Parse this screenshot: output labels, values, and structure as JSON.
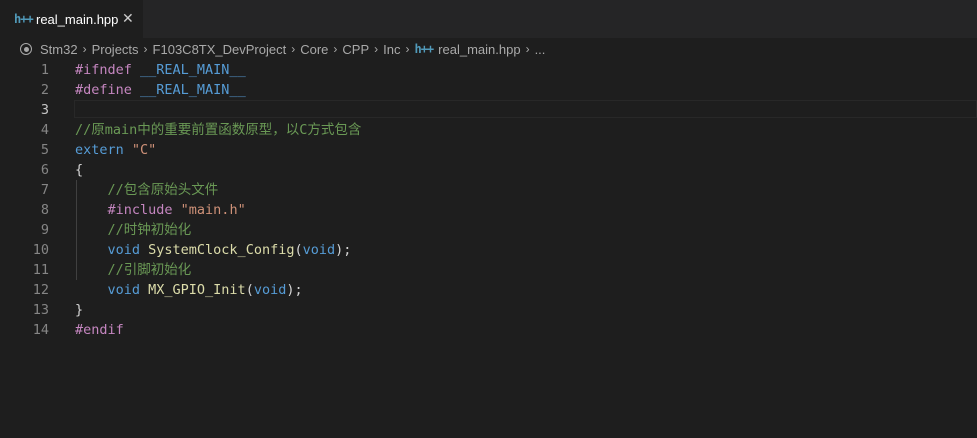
{
  "tab": {
    "icon_text": "h++",
    "label": "real_main.hpp",
    "close": "✕"
  },
  "breadcrumb": {
    "items": [
      "Stm32",
      "Projects",
      "F103C8TX_DevProject",
      "Core",
      "CPP",
      "Inc"
    ],
    "file_icon": "h++",
    "file": "real_main.hpp",
    "tail": "...",
    "separator": "›"
  },
  "lines": [
    {
      "n": "1",
      "parts": [
        [
          "pp",
          "#ifndef "
        ],
        [
          "macro",
          "__REAL_MAIN__"
        ]
      ]
    },
    {
      "n": "2",
      "parts": [
        [
          "pp",
          "#define "
        ],
        [
          "macro",
          "__REAL_MAIN__"
        ]
      ]
    },
    {
      "n": "3",
      "parts": [],
      "current": true
    },
    {
      "n": "4",
      "parts": [
        [
          "comment",
          "//原main中的重要前置函数原型，以C方式包含"
        ]
      ]
    },
    {
      "n": "5",
      "parts": [
        [
          "kw",
          "extern "
        ],
        [
          "str",
          "\"C\""
        ]
      ]
    },
    {
      "n": "6",
      "parts": [
        [
          "punc",
          "{"
        ]
      ]
    },
    {
      "n": "7",
      "parts": [
        [
          "punc",
          "    "
        ],
        [
          "comment",
          "//包含原始头文件"
        ]
      ]
    },
    {
      "n": "8",
      "parts": [
        [
          "punc",
          "    "
        ],
        [
          "pp",
          "#include "
        ],
        [
          "str",
          "\"main.h\""
        ]
      ]
    },
    {
      "n": "9",
      "parts": [
        [
          "punc",
          "    "
        ],
        [
          "comment",
          "//时钟初始化"
        ]
      ]
    },
    {
      "n": "10",
      "parts": [
        [
          "punc",
          "    "
        ],
        [
          "kw",
          "void "
        ],
        [
          "fn",
          "SystemClock_Config"
        ],
        [
          "punc",
          "("
        ],
        [
          "kw",
          "void"
        ],
        [
          "punc",
          ");"
        ]
      ]
    },
    {
      "n": "11",
      "parts": [
        [
          "punc",
          "    "
        ],
        [
          "comment",
          "//引脚初始化"
        ]
      ]
    },
    {
      "n": "12",
      "parts": [
        [
          "punc",
          "    "
        ],
        [
          "kw",
          "void "
        ],
        [
          "fn",
          "MX_GPIO_Init"
        ],
        [
          "punc",
          "("
        ],
        [
          "kw",
          "void"
        ],
        [
          "punc",
          ");"
        ]
      ]
    },
    {
      "n": "13",
      "parts": [
        [
          "punc",
          "}"
        ]
      ]
    },
    {
      "n": "14",
      "parts": [
        [
          "pp",
          "#endif"
        ]
      ]
    }
  ]
}
